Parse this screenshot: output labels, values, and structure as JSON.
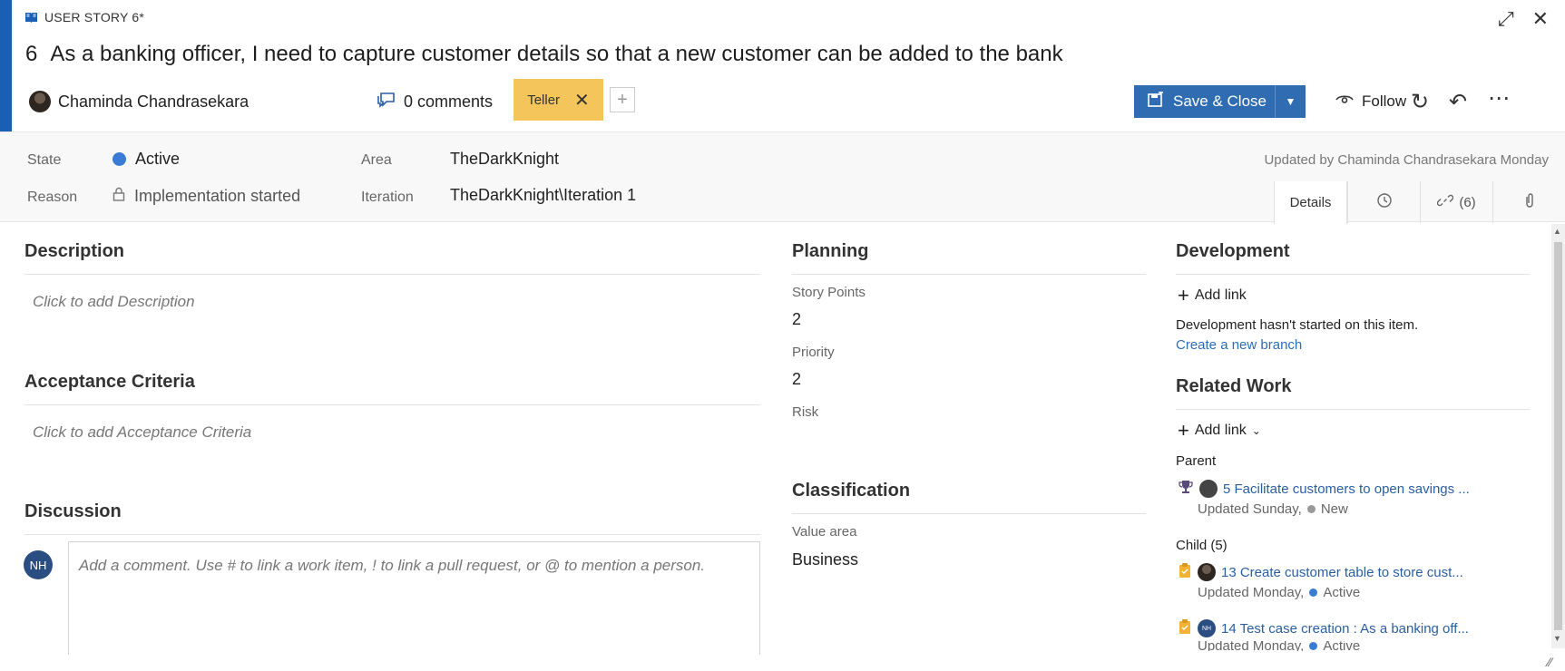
{
  "header": {
    "type_label": "USER STORY 6*",
    "id": "6",
    "title": "As a banking officer, I need to capture customer details so that a new customer can be added to the bank",
    "assignee": "Chaminda Chandrasekara",
    "comments_label": "0 comments",
    "tag": "Teller",
    "save_label": "Save & Close",
    "follow_label": "Follow",
    "accent_color": "#1a5fb4",
    "save_color": "#2f6cb1",
    "tag_color": "#f4c55b"
  },
  "fields": {
    "state_label": "State",
    "state_value": "Active",
    "reason_label": "Reason",
    "reason_value": "Implementation started",
    "area_label": "Area",
    "area_value": "TheDarkKnight",
    "iteration_label": "Iteration",
    "iteration_value": "TheDarkKnight\\Iteration 1",
    "updated_text": "Updated by Chaminda Chandrasekara Monday"
  },
  "tabs": {
    "details": "Details",
    "links": "(6)"
  },
  "description": {
    "title": "Description",
    "placeholder": "Click to add Description"
  },
  "acceptance": {
    "title": "Acceptance Criteria",
    "placeholder": "Click to add Acceptance Criteria"
  },
  "discussion": {
    "title": "Discussion",
    "avatar_initials": "NH",
    "placeholder": "Add a comment. Use # to link a work item, ! to link a pull request, or @ to mention a person."
  },
  "planning": {
    "title": "Planning",
    "story_points_label": "Story Points",
    "story_points_value": "2",
    "priority_label": "Priority",
    "priority_value": "2",
    "risk_label": "Risk"
  },
  "classification": {
    "title": "Classification",
    "value_area_label": "Value area",
    "value_area_value": "Business"
  },
  "development": {
    "title": "Development",
    "add_link": "Add link",
    "not_started": "Development hasn't started on this item.",
    "create_branch": "Create a new branch"
  },
  "related_work": {
    "title": "Related Work",
    "add_link": "Add link",
    "parent_label": "Parent",
    "parent_item": "5 Facilitate customers to open savings ...",
    "parent_updated": "Updated Sunday,",
    "parent_state": "New",
    "child_label": "Child (5)",
    "child1_item": "13 Create customer table to store cust...",
    "child1_updated": "Updated Monday,",
    "child1_state": "Active",
    "child2_item": "14 Test case creation : As a banking off...",
    "child2_updated": "Updated Monday,",
    "child2_state": "Active",
    "child2_avatar_initials": "NH"
  }
}
